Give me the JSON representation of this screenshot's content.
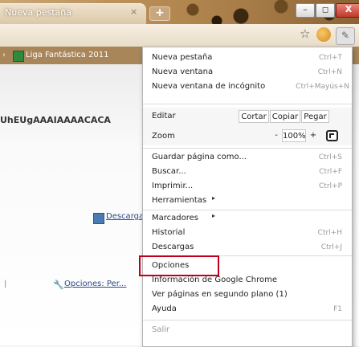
{
  "window": {
    "tab_title": "Nueva pestaña",
    "tab_close": "×",
    "new_tab": "+",
    "minimize": "–",
    "maximize": "◻",
    "close": "X"
  },
  "bookmarks": {
    "prev": "‹",
    "item_label": "Liga Fantástica 2011"
  },
  "page": {
    "code_text": "UhEUgAAAIAAAACACA",
    "download_link": "Descargar pro...",
    "options_link": "Opciones: Per...",
    "dot": "|"
  },
  "menu": {
    "nueva_pestana": {
      "label": "Nueva pestaña",
      "shortcut": "Ctrl+T"
    },
    "nueva_ventana": {
      "label": "Nueva ventana",
      "shortcut": "Ctrl+N"
    },
    "incognito": {
      "label": "Nueva ventana de incógnito",
      "shortcut": "Ctrl+Mayús+N"
    },
    "editar": {
      "label": "Editar",
      "cut": "Cortar",
      "copy": "Copiar",
      "paste": "Pegar"
    },
    "zoom": {
      "label": "Zoom",
      "minus": "-",
      "value": "100%",
      "plus": "+"
    },
    "guardar": {
      "label": "Guardar página como...",
      "shortcut": "Ctrl+S"
    },
    "buscar": {
      "label": "Buscar...",
      "shortcut": "Ctrl+F"
    },
    "imprimir": {
      "label": "Imprimir...",
      "shortcut": "Ctrl+P"
    },
    "herramientas": {
      "label": "Herramientas",
      "arrow": "▸"
    },
    "marcadores": {
      "label": "Marcadores",
      "arrow": "▸"
    },
    "historial": {
      "label": "Historial",
      "shortcut": "Ctrl+H"
    },
    "descargas": {
      "label": "Descargas",
      "shortcut": "Ctrl+J"
    },
    "opciones": {
      "label": "Opciones"
    },
    "informacion": {
      "label": "Información de Google Chrome"
    },
    "segundo_plano": {
      "label": "Ver páginas en segundo plano (1)"
    },
    "ayuda": {
      "label": "Ayuda",
      "shortcut": "F1"
    },
    "salir": {
      "label": "Salir"
    }
  },
  "icons": {
    "star": "☆",
    "wrench": "✎",
    "options_page_icon": "🔧"
  }
}
